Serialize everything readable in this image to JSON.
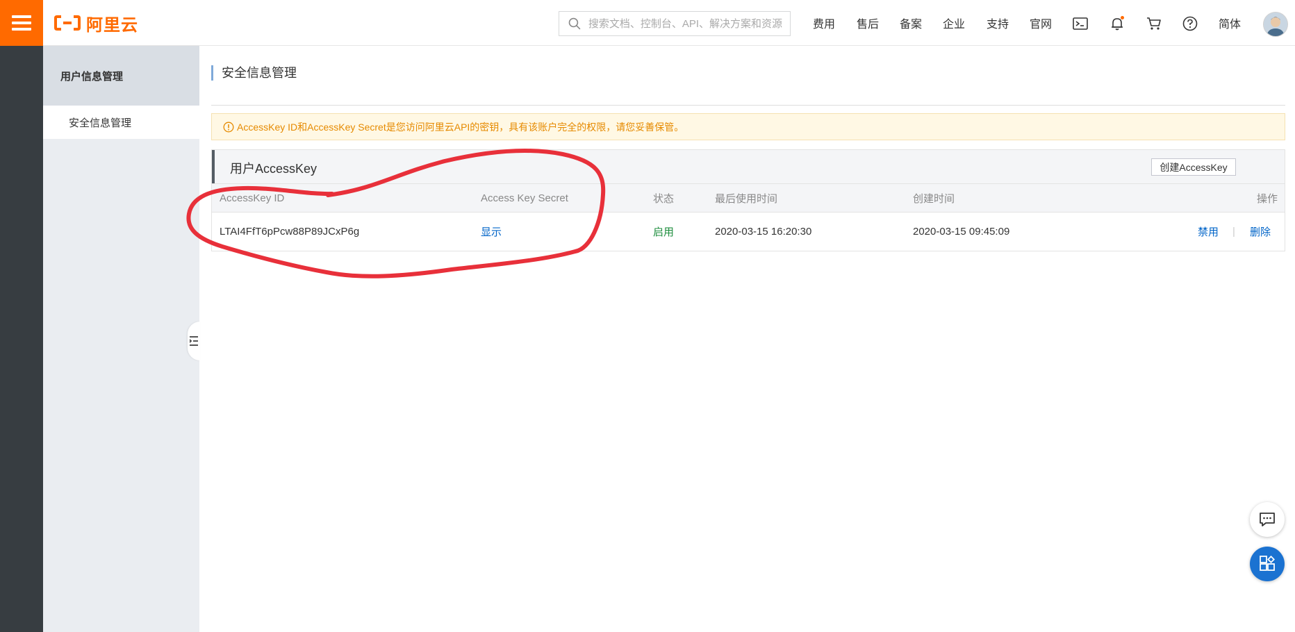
{
  "topbar": {
    "logo_text": "阿里云",
    "search_placeholder": "搜索文档、控制台、API、解决方案和资源",
    "nav": [
      "费用",
      "售后",
      "备案",
      "企业",
      "支持",
      "官网"
    ],
    "language": "简体",
    "icons": [
      "menu-icon",
      "terminal-icon",
      "bell-icon",
      "cart-icon",
      "help-icon"
    ],
    "accent_color": "#ff6a00"
  },
  "sidebar": {
    "header": "用户信息管理",
    "items": [
      {
        "label": "安全信息管理"
      }
    ]
  },
  "main": {
    "title": "安全信息管理",
    "alert": "AccessKey ID和AccessKey Secret是您访问阿里云API的密钥，具有该账户完全的权限，请您妥善保管。",
    "panel": {
      "title": "用户AccessKey",
      "create_label": "创建AccessKey",
      "columns": [
        "AccessKey ID",
        "Access Key Secret",
        "状态",
        "最后使用时间",
        "创建时间",
        "操作"
      ],
      "rows": [
        {
          "id": "LTAI4FfT6pPcw88P89JCxP6g",
          "secret": "显示",
          "status": "启用",
          "last_used": "2020-03-15 16:20:30",
          "created": "2020-03-15 09:45:09",
          "actions": [
            "禁用",
            "删除"
          ]
        }
      ]
    }
  },
  "annotation_color": "#e8303a"
}
